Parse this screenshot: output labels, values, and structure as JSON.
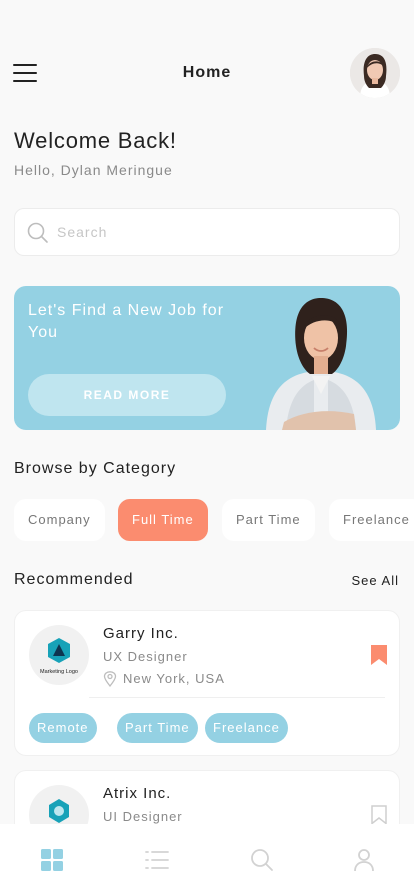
{
  "header": {
    "title": "Home",
    "menu_icon": "hamburger-menu-icon",
    "avatar": "user-avatar"
  },
  "welcome": {
    "title": "Welcome Back!",
    "greeting": "Hello, Dylan Meringue"
  },
  "search": {
    "placeholder": "Search",
    "value": "",
    "icon": "search-icon"
  },
  "banner": {
    "text": "Let's Find a New Job for You",
    "button_label": "READ MORE"
  },
  "categories": {
    "title": "Browse by Category",
    "items": [
      "Company",
      "Full Time",
      "Part Time",
      "Freelance"
    ],
    "active": "Full Time"
  },
  "recommended": {
    "title": "Recommended",
    "see_all": "See All",
    "jobs": [
      {
        "company": "Garry Inc.",
        "role": "UX Designer",
        "location": "New York, USA",
        "logo_text": "Marketing Logo",
        "bookmarked": true,
        "tags": [
          "Remote",
          "Part Time",
          "Freelance"
        ]
      },
      {
        "company": "Atrix Inc.",
        "role": "UI Designer",
        "bookmarked": false
      }
    ]
  },
  "nav": {
    "items": [
      "grid-icon",
      "list-icon",
      "search-icon",
      "profile-icon"
    ],
    "active": "grid-icon"
  },
  "colors": {
    "accent_blue": "#94d1e3",
    "accent_orange": "#fb8c6f",
    "background": "#f9f9f9"
  }
}
